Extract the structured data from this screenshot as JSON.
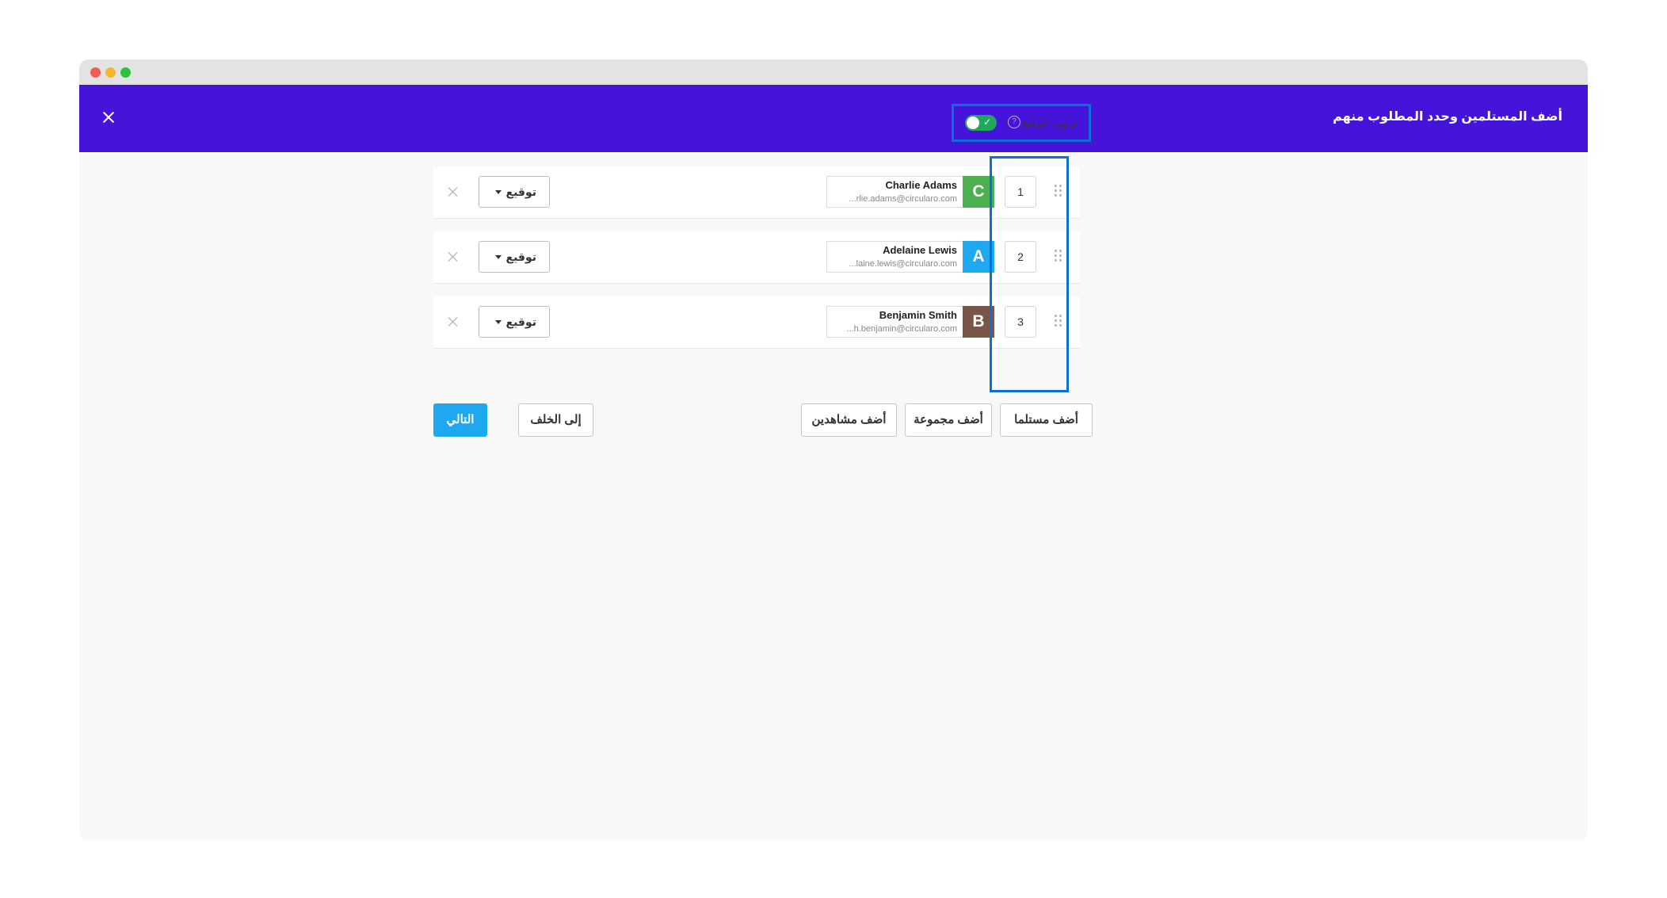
{
  "header": {
    "title": "أضف المستلمين وحدد المطلوب منهم"
  },
  "signing_order": {
    "label": "ترتيب التوقيع",
    "help": "?",
    "enabled": true,
    "toggle_check": "✓"
  },
  "recipients": [
    {
      "order": "1",
      "initial": "C",
      "avatar_color": "#4caf50",
      "name": "Charlie Adams",
      "email": "...rlie.adams@circularo.com",
      "role": "توقيع"
    },
    {
      "order": "2",
      "initial": "A",
      "avatar_color": "#1ea8f0",
      "name": "Adelaine Lewis",
      "email": "...laine.lewis@circularo.com",
      "role": "توقيع"
    },
    {
      "order": "3",
      "initial": "B",
      "avatar_color": "#79554a",
      "name": "Benjamin Smith",
      "email": "...h.benjamin@circularo.com",
      "role": "توقيع"
    }
  ],
  "actions": {
    "add_recipient": "أضف مستلما",
    "add_group": "أضف مجموعة",
    "add_viewers": "أضف مشاهدين",
    "back": "إلى الخلف",
    "next": "التالي"
  },
  "colors": {
    "header": "#4613da",
    "accent": "#1ea8f0",
    "toggle_on": "#21a85a",
    "highlight": "#0a6fd6"
  }
}
